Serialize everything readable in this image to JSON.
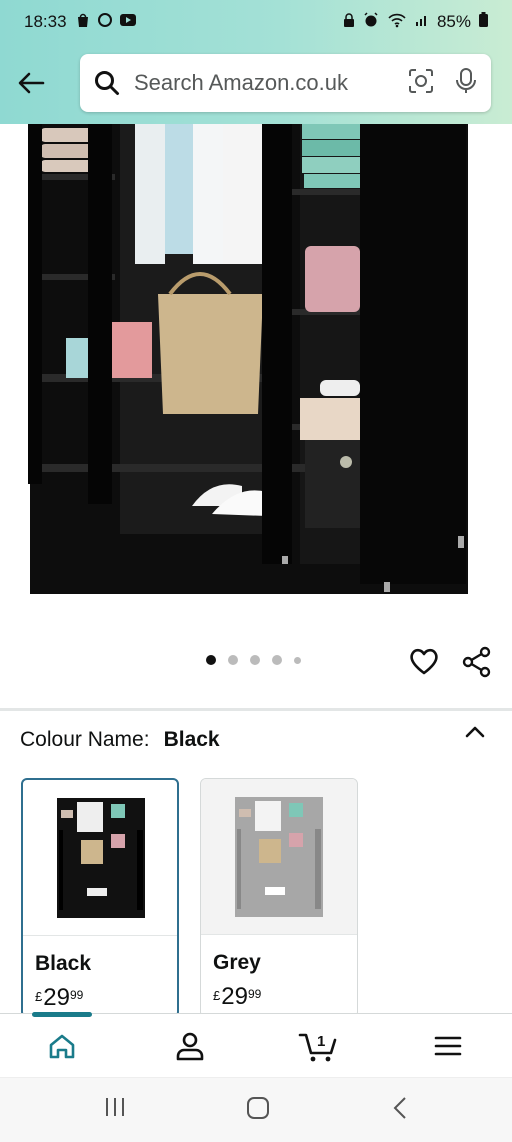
{
  "status_bar": {
    "time": "18:33",
    "battery": "85%"
  },
  "search": {
    "placeholder": "Search Amazon.co.uk"
  },
  "gallery": {
    "dot_count": 5,
    "active_index": 0
  },
  "variation": {
    "label": "Colour Name:",
    "selected_value": "Black",
    "options": [
      {
        "name": "Black",
        "currency": "£",
        "whole": "29",
        "fraction": "99",
        "selected": true
      },
      {
        "name": "Grey",
        "currency": "£",
        "whole": "29",
        "fraction": "99",
        "selected": false
      }
    ]
  },
  "bottom_nav": {
    "items": [
      "home-icon",
      "account-icon",
      "cart-icon",
      "menu-icon"
    ],
    "cart_count": "1",
    "active": "home",
    "accent": "#1a7b8a"
  }
}
